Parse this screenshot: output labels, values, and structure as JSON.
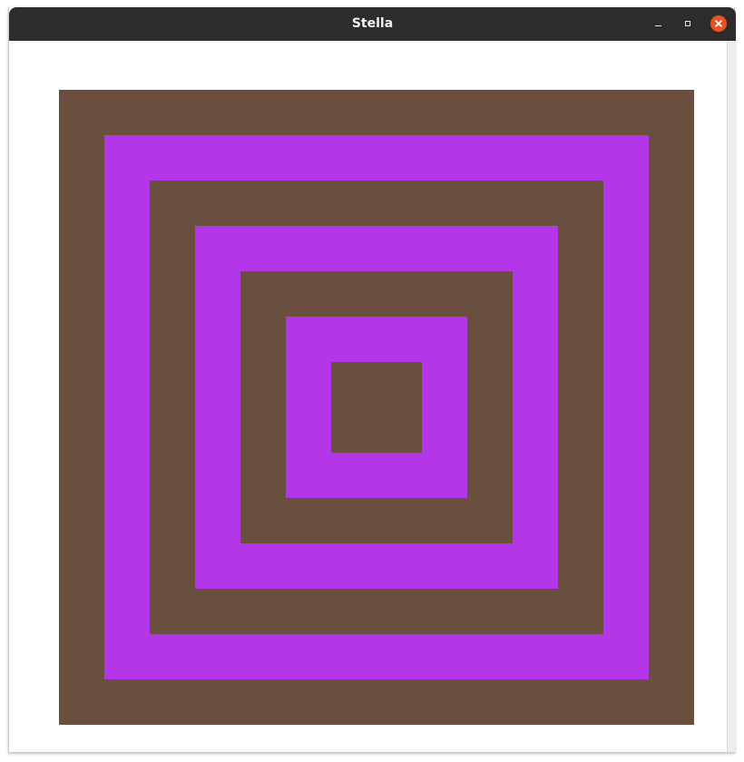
{
  "window": {
    "title": "Stella"
  },
  "icons": {
    "minimize": "minimize-icon",
    "maximize": "maximize-icon",
    "close": "close-icon"
  },
  "colors": {
    "titlebar": "#2f2d2b",
    "close_button": "#e95420",
    "brown": "#6a4e3e",
    "purple": "#b437e7"
  },
  "artwork": {
    "rings": [
      {
        "color": "#6a4e3e"
      },
      {
        "color": "#b437e7"
      },
      {
        "color": "#6a4e3e"
      },
      {
        "color": "#b437e7"
      },
      {
        "color": "#6a4e3e"
      },
      {
        "color": "#b437e7"
      },
      {
        "color": "#6a4e3e"
      }
    ]
  }
}
